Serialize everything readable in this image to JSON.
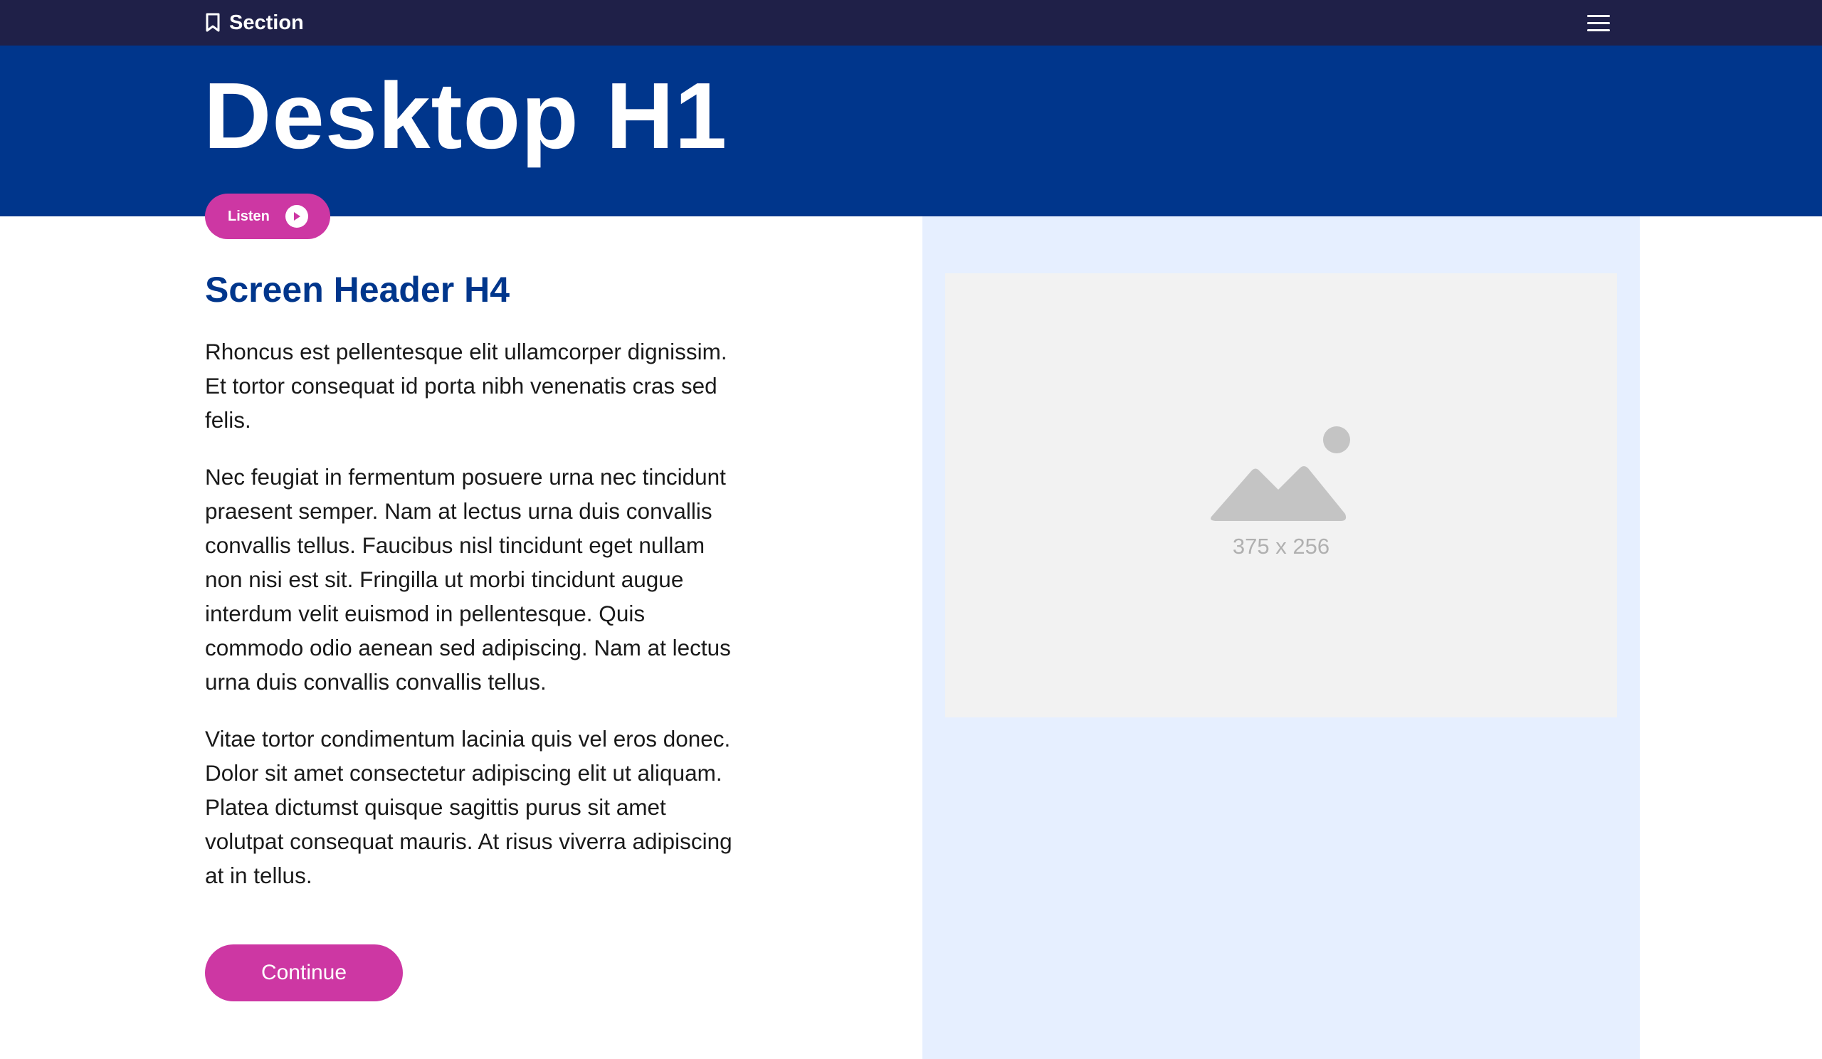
{
  "topbar": {
    "section_label": "Section",
    "bookmark_icon": "bookmark-icon",
    "menu_icon": "hamburger-menu-icon"
  },
  "hero": {
    "title": "Desktop H1"
  },
  "listen_button": {
    "label": "Listen",
    "icon": "play-icon"
  },
  "content": {
    "heading": "Screen Header H4",
    "paragraphs": [
      "Rhoncus est pellentesque elit ullamcorper dignissim. Et tortor consequat id porta nibh venenatis cras sed felis.",
      "Nec feugiat in fermentum posuere urna nec tincidunt praesent semper. Nam at lectus urna duis convallis convallis tellus. Faucibus nisl tincidunt eget nullam non nisi est sit. Fringilla ut morbi tincidunt augue interdum velit euismod in pellentesque. Quis commodo odio aenean sed adipiscing. Nam at lectus urna duis convallis convallis tellus.",
      "Vitae tortor condimentum lacinia quis vel eros donec. Dolor sit amet consectetur adipiscing elit ut aliquam. Platea dictumst quisque sagittis purus sit amet volutpat consequat mauris. At risus viverra adipiscing at in tellus."
    ],
    "continue_label": "Continue"
  },
  "image_placeholder": {
    "icon": "image-placeholder-icon",
    "size_label": "375 x 256"
  },
  "colors": {
    "topbar": "#1f2048",
    "hero": "#00368c",
    "accent": "#cd37a3",
    "panel": "#e6efff",
    "placeholder": "#f2f2f2"
  }
}
